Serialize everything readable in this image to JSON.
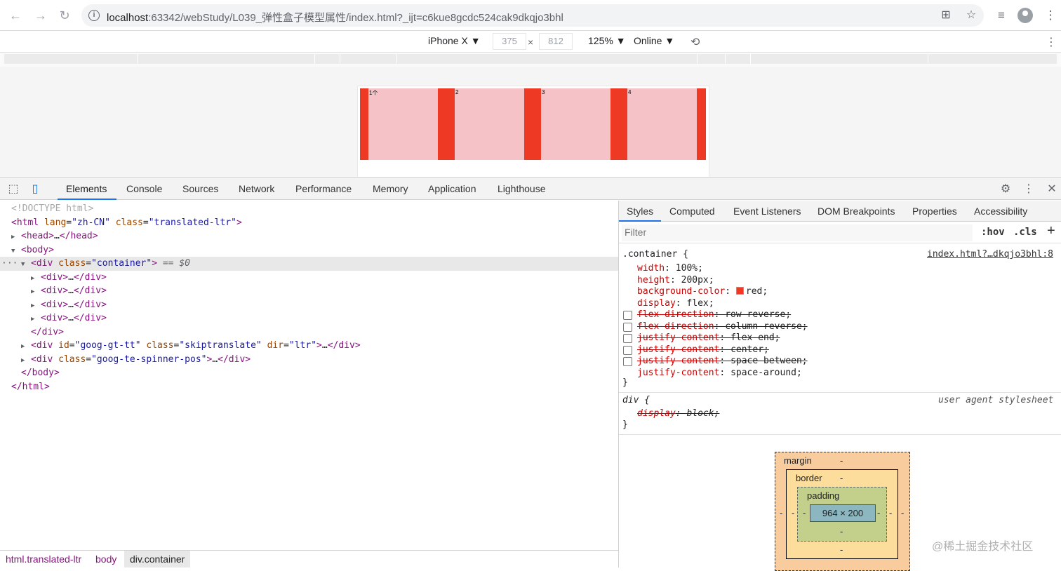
{
  "browser": {
    "url_host": "localhost",
    "url_rest": ":63342/webStudy/L039_弹性盒子模型属性/index.html?_ijt=c6kue8gcdc524cak9dkqjo3bhl"
  },
  "device_toolbar": {
    "device": "iPhone X ▼",
    "width": "375",
    "times": "×",
    "height": "812",
    "zoom": "125% ▼",
    "network": "Online ▼"
  },
  "preview": {
    "items": [
      "1个",
      "2",
      "3",
      "4"
    ]
  },
  "devtools": {
    "tabs": [
      "Elements",
      "Console",
      "Sources",
      "Network",
      "Performance",
      "Memory",
      "Application",
      "Lighthouse"
    ],
    "active_tab": "Elements"
  },
  "elements": {
    "doctype": "<!DOCTYPE html>",
    "html_lang": "\"zh-CN\"",
    "html_class": "\"translated-ltr\"",
    "container_class": "\"container\"",
    "eq": "== $0",
    "ellipsis": "…",
    "goog_id": "\"goog-gt-tt\"",
    "goog_class": "\"skiptranslate\"",
    "goog_dir": "\"ltr\"",
    "spinner_class": "\"goog-te-spinner-pos\""
  },
  "breadcrumb": [
    "html.translated-ltr",
    "body",
    "div.container"
  ],
  "styles": {
    "tabs": [
      "Styles",
      "Computed",
      "Event Listeners",
      "DOM Breakpoints",
      "Properties",
      "Accessibility"
    ],
    "filter_placeholder": "Filter",
    "hov": ":hov",
    "cls": ".cls",
    "plus": "+",
    "rule1": {
      "selector": ".container {",
      "source": "index.html?…dkqjo3bhl:8",
      "props": [
        {
          "name": "width",
          "value": "100%;",
          "disabled": false
        },
        {
          "name": "height",
          "value": "200px;",
          "disabled": false
        },
        {
          "name": "background-color",
          "value": "red;",
          "disabled": false
        },
        {
          "name": "display",
          "value": "flex;",
          "disabled": false
        },
        {
          "name": "flex-direction",
          "value": "row-reverse;",
          "disabled": true
        },
        {
          "name": "flex-direction",
          "value": "column-reverse;",
          "disabled": true
        },
        {
          "name": "justify-content",
          "value": "flex-end;",
          "disabled": true
        },
        {
          "name": "justify-content",
          "value": "center;",
          "disabled": true
        },
        {
          "name": "justify-content",
          "value": "space-between;",
          "disabled": true
        },
        {
          "name": "justify-content",
          "value": "space-around;",
          "disabled": false
        }
      ],
      "close": "}"
    },
    "rule2": {
      "selector": "div {",
      "source": "user agent stylesheet",
      "prop_name": "display",
      "prop_value": "block;",
      "close": "}"
    }
  },
  "box_model": {
    "margin": "margin",
    "border": "border",
    "padding": "padding",
    "content": "964 × 200",
    "dash": "-"
  },
  "watermark": "@稀土掘金技术社区",
  "colors": {
    "container_red": "#ee3a24",
    "item_pink": "#f5c2c7",
    "accent_blue": "#1a73e8"
  }
}
